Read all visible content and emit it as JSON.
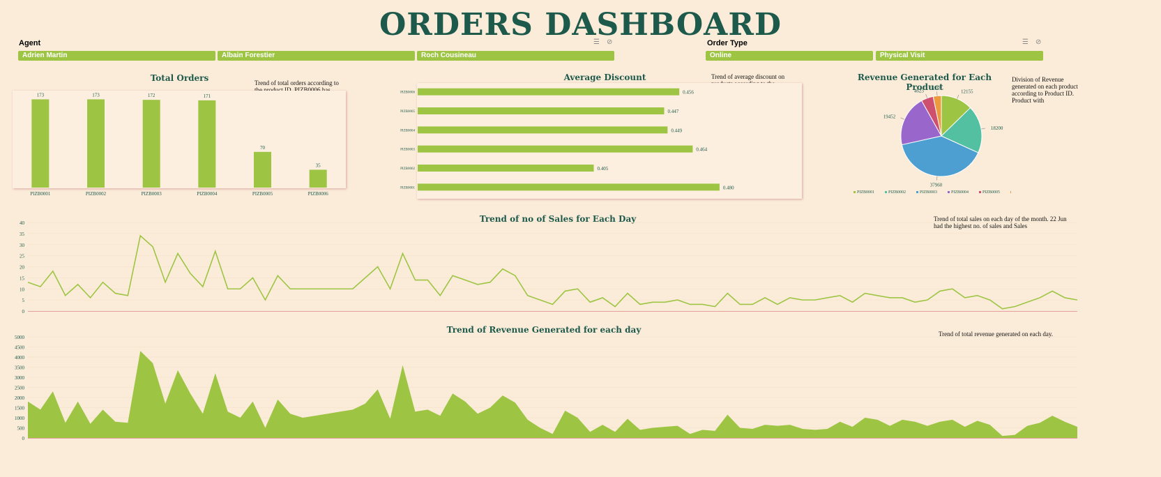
{
  "header": {
    "title": "ORDERS DASHBOARD"
  },
  "slicers": {
    "agent": {
      "label": "Agent",
      "items": [
        "Adrien Martin",
        "Albain Forestier",
        "Roch Cousineau"
      ]
    },
    "order_type": {
      "label": "Order Type",
      "items": [
        "Online",
        "Physical Visit"
      ]
    }
  },
  "icons": {
    "multi_select": "multi-select-icon",
    "clear_filter": "clear-filter-icon"
  },
  "notes": {
    "total_orders": "Trend of total orders according to the product ID. PIZB0006 has",
    "avg_discount": "Trend of average discount on products according to the",
    "revenue_product": "Division of Revenue generated on each product according to Product ID. Product with",
    "sales_day": "Trend of total sales on each day of the month. 22 Jun had the highest no. of sales and Sales",
    "revenue_day": "Trend of total revenue generated on each day."
  },
  "colors": {
    "accent": "#9dc543",
    "title": "#1e5a4c",
    "background": "#fbecd9"
  },
  "chart_data": [
    {
      "id": "total_orders",
      "type": "bar",
      "title": "Total Orders",
      "categories": [
        "PIZB0001",
        "PIZB0002",
        "PIZB0003",
        "PIZB0004",
        "PIZB0005",
        "PIZB0006"
      ],
      "values": [
        173,
        173,
        172,
        171,
        70,
        35
      ],
      "ylim": [
        0,
        190
      ]
    },
    {
      "id": "avg_discount",
      "type": "bar",
      "orientation": "horizontal",
      "title": "Average Discount",
      "categories": [
        "PIZB0006",
        "PIZB0005",
        "PIZB0004",
        "PIZB0003",
        "PIZB0002",
        "PIZB0001"
      ],
      "values": [
        0.456,
        0.447,
        0.449,
        0.464,
        0.405,
        0.48
      ],
      "xlim": [
        0.3,
        0.5
      ],
      "labels": [
        "0.456",
        "0.447",
        "0.449",
        "0.464",
        "0.405",
        "0.480"
      ]
    },
    {
      "id": "revenue_product",
      "type": "pie",
      "title": "Revenue Generated for Each Product",
      "categories": [
        "PIZB0001",
        "PIZB0002",
        "PIZB0003",
        "PIZB0004",
        "PIZB0005",
        "PIZB0006"
      ],
      "values": [
        12155,
        18200,
        37960,
        19452,
        4623,
        3118
      ],
      "colors": [
        "#9dc543",
        "#52c0a1",
        "#4d9fd1",
        "#9966cc",
        "#cf4f6e",
        "#ed9a3e"
      ],
      "legend": "bottom"
    },
    {
      "id": "sales_day",
      "type": "line",
      "title": "Trend of no of Sales for Each Day",
      "values": [
        13,
        11,
        18,
        7,
        12,
        6,
        13,
        8,
        7,
        34,
        29,
        13,
        26,
        17,
        11,
        27,
        10,
        10,
        15,
        5,
        16,
        10,
        10,
        10,
        10,
        10,
        10,
        15,
        20,
        10,
        26,
        14,
        14,
        7,
        16,
        14,
        12,
        13,
        19,
        16,
        7,
        5,
        3,
        9,
        10,
        4,
        6,
        2,
        8,
        3,
        4,
        4,
        5,
        3,
        3,
        2,
        8,
        3,
        3,
        6,
        3,
        6,
        5,
        5,
        6,
        7,
        4,
        8,
        7,
        6,
        6,
        4,
        5,
        9,
        10,
        6,
        7,
        5,
        1,
        2,
        4,
        6,
        9,
        6,
        5
      ],
      "yticks": [
        "0",
        "5",
        "10",
        "15",
        "20",
        "25",
        "30",
        "35",
        "40"
      ],
      "ylim": [
        0,
        40
      ]
    },
    {
      "id": "revenue_day",
      "type": "area",
      "title": "Trend of Revenue Generated for each day",
      "values": [
        1800,
        1400,
        2300,
        750,
        1800,
        700,
        1400,
        800,
        750,
        4300,
        3700,
        1700,
        3350,
        2200,
        1200,
        3200,
        1300,
        1000,
        1800,
        500,
        1900,
        1200,
        1000,
        1100,
        1200,
        1300,
        1400,
        1700,
        2400,
        950,
        3600,
        1300,
        1400,
        1100,
        2200,
        1800,
        1200,
        1500,
        2100,
        1750,
        900,
        500,
        200,
        1350,
        1000,
        300,
        650,
        300,
        950,
        400,
        500,
        550,
        600,
        200,
        400,
        350,
        1150,
        500,
        450,
        650,
        600,
        650,
        450,
        400,
        450,
        800,
        550,
        1000,
        900,
        600,
        900,
        800,
        600,
        800,
        900,
        550,
        850,
        650,
        100,
        150,
        600,
        750,
        1100,
        800,
        550
      ],
      "yticks": [
        "0",
        "500",
        "1000",
        "1500",
        "2000",
        "2500",
        "3000",
        "3500",
        "4000",
        "4500",
        "5000"
      ],
      "ylim": [
        0,
        5000
      ]
    }
  ]
}
